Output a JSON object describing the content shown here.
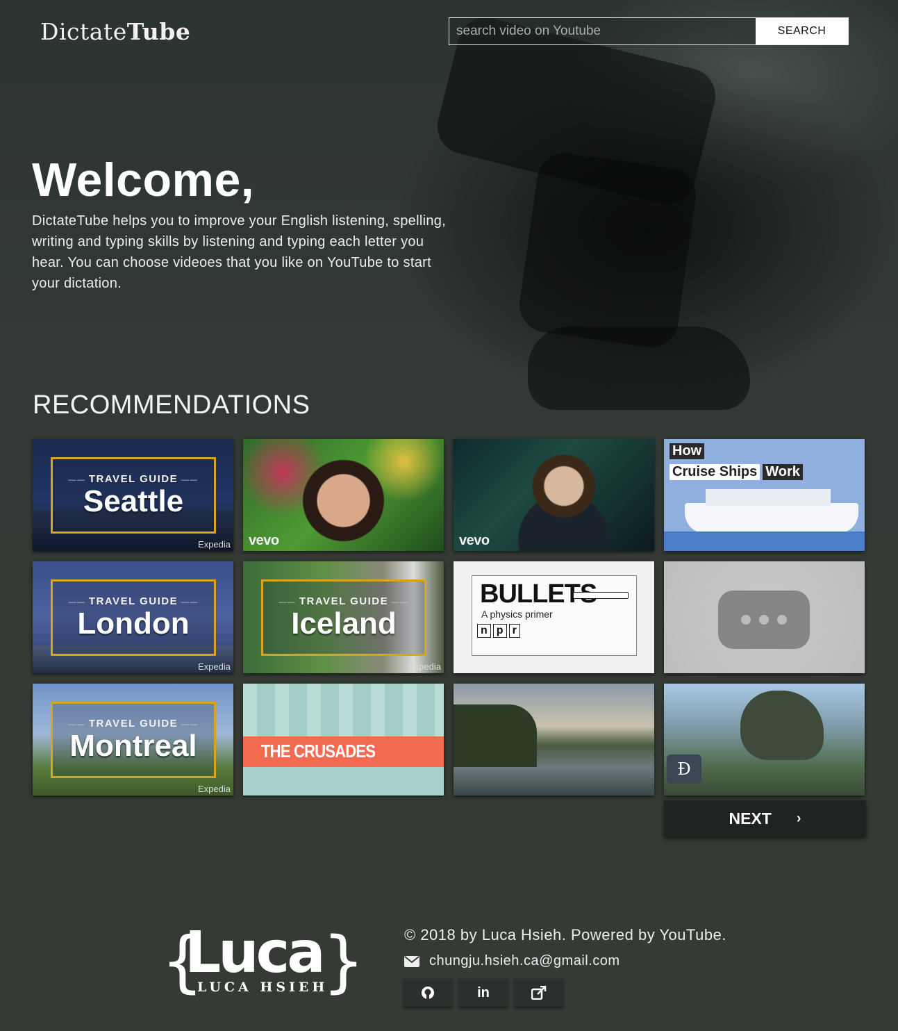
{
  "header": {
    "logo_light": "Dictate",
    "logo_bold": "Tube",
    "search_placeholder": "search video on Youtube",
    "search_label": "SEARCH"
  },
  "hero": {
    "title": "Welcome,",
    "text": "DictateTube helps you to improve your English listening, spelling, writing and typing skills by listening and typing each letter you hear. You can choose videoes that you like on YouTube to start your dictation."
  },
  "recommendations": {
    "title": "RECOMMENDATIONS",
    "next_label": "NEXT",
    "videos": [
      {
        "kind": "travel-guide",
        "label": "TRAVEL GUIDE",
        "city": "Seattle",
        "brand": "Expedia"
      },
      {
        "kind": "music",
        "brand": "vevo"
      },
      {
        "kind": "music",
        "brand": "vevo"
      },
      {
        "kind": "cruise",
        "line1": "How",
        "line2a": "Cruise Ships",
        "line2b": "Work"
      },
      {
        "kind": "travel-guide",
        "label": "TRAVEL GUIDE",
        "city": "London",
        "brand": "Expedia"
      },
      {
        "kind": "travel-guide",
        "label": "TRAVEL GUIDE",
        "city": "Iceland",
        "brand": "Expedia"
      },
      {
        "kind": "npr",
        "title": "BULLETS",
        "subtitle": "A physics primer",
        "brand": [
          "n",
          "p",
          "r"
        ]
      },
      {
        "kind": "placeholder"
      },
      {
        "kind": "travel-guide",
        "label": "TRAVEL GUIDE",
        "city": "Montreal",
        "brand": "Expedia"
      },
      {
        "kind": "crusades",
        "title": "THE CRUSADES"
      },
      {
        "kind": "landscape"
      },
      {
        "kind": "disney"
      }
    ]
  },
  "footer": {
    "logo_main": "Luca",
    "logo_sub": "LUCA HSIEH",
    "copyright": "© 2018 by Luca Hsieh. Powered by YouTube.",
    "email": "chungju.hsieh.ca@gmail.com",
    "social": [
      {
        "icon": "github-icon"
      },
      {
        "icon": "linkedin-icon",
        "text": "in"
      },
      {
        "icon": "external-link-icon"
      }
    ]
  }
}
